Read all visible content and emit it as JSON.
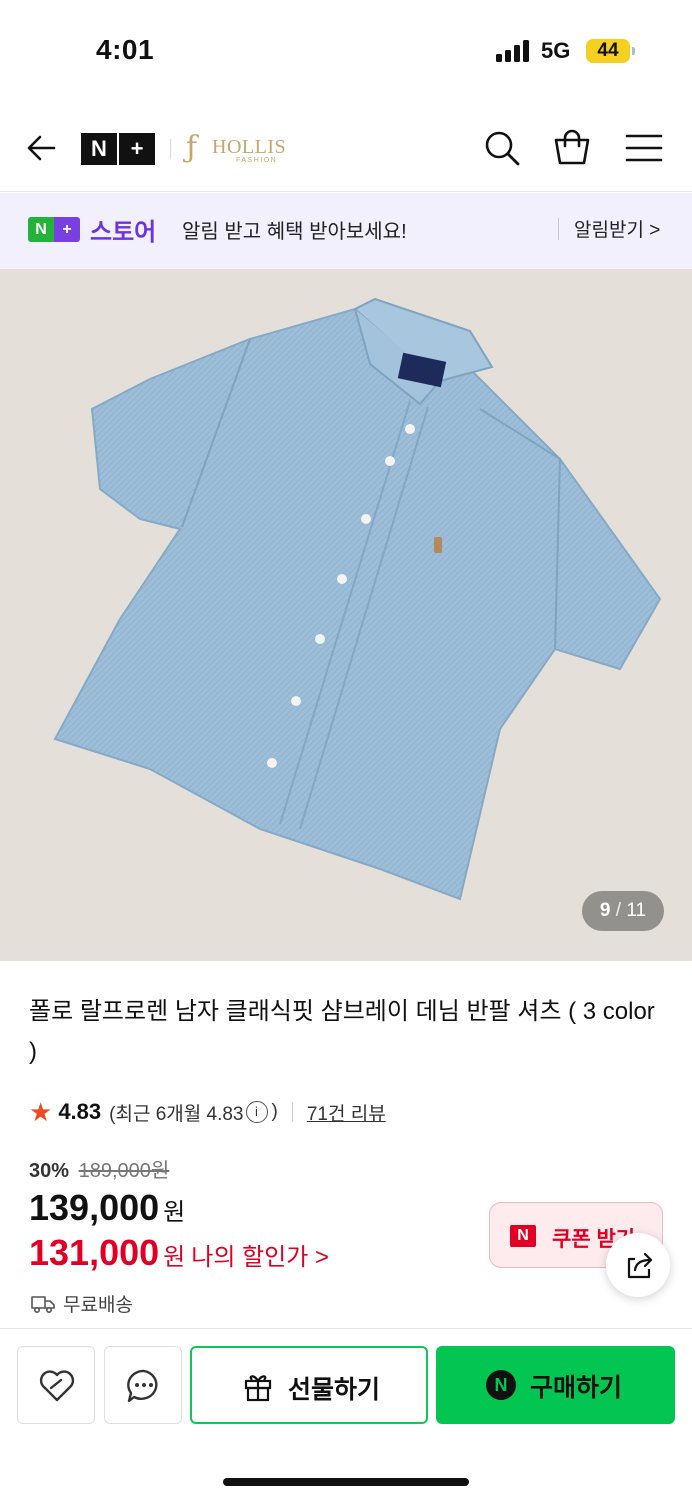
{
  "status_bar": {
    "time": "4:01",
    "network": "5G",
    "battery": "44"
  },
  "header": {
    "nplus_left": "N",
    "nplus_right": "+",
    "brand_mark": "ƒ",
    "brand_name": "HOLLIS",
    "brand_sub": "FASHION"
  },
  "banner": {
    "badge_left": "N",
    "badge_right": "+",
    "store_label": "스토어",
    "message": "알림 받고 혜택 받아보세요!",
    "cta": "알림받기 >"
  },
  "gallery": {
    "current": "9",
    "separator": "/",
    "total": "11"
  },
  "product": {
    "title": "폴로 랄프로렌 남자 클래식핏 샴브레이 데님 반팔 셔츠 ( 3 color )",
    "rating_score": "4.83",
    "recent_label": "(최근 6개월 4.83",
    "recent_close": ")",
    "info_icon": "i",
    "review_count": "71건 리뷰",
    "discount_rate": "30%",
    "original_price": "189,000원",
    "price": "139,000",
    "price_unit": "원",
    "my_price": "131,000",
    "my_price_unit": "원",
    "my_price_label": "나의 할인가 >",
    "coupon_logo": "N",
    "coupon_label": "쿠폰 받기",
    "shipping": "무료배송"
  },
  "bottom_bar": {
    "gift_label": "선물하기",
    "buy_logo": "N",
    "buy_label": "구매하기"
  },
  "colors": {
    "naver_green": "#02c651",
    "discount_red": "#e10024",
    "store_purple": "#6a35e0",
    "banner_bg": "#f2f0fd",
    "shirt_blue": "#9dbed8"
  },
  "icons": [
    "back-arrow-icon",
    "search-icon",
    "shopping-bag-icon",
    "menu-icon",
    "star-icon",
    "info-icon",
    "truck-icon",
    "share-icon",
    "heart-icon",
    "chat-icon",
    "gift-icon",
    "naver-n-icon"
  ]
}
